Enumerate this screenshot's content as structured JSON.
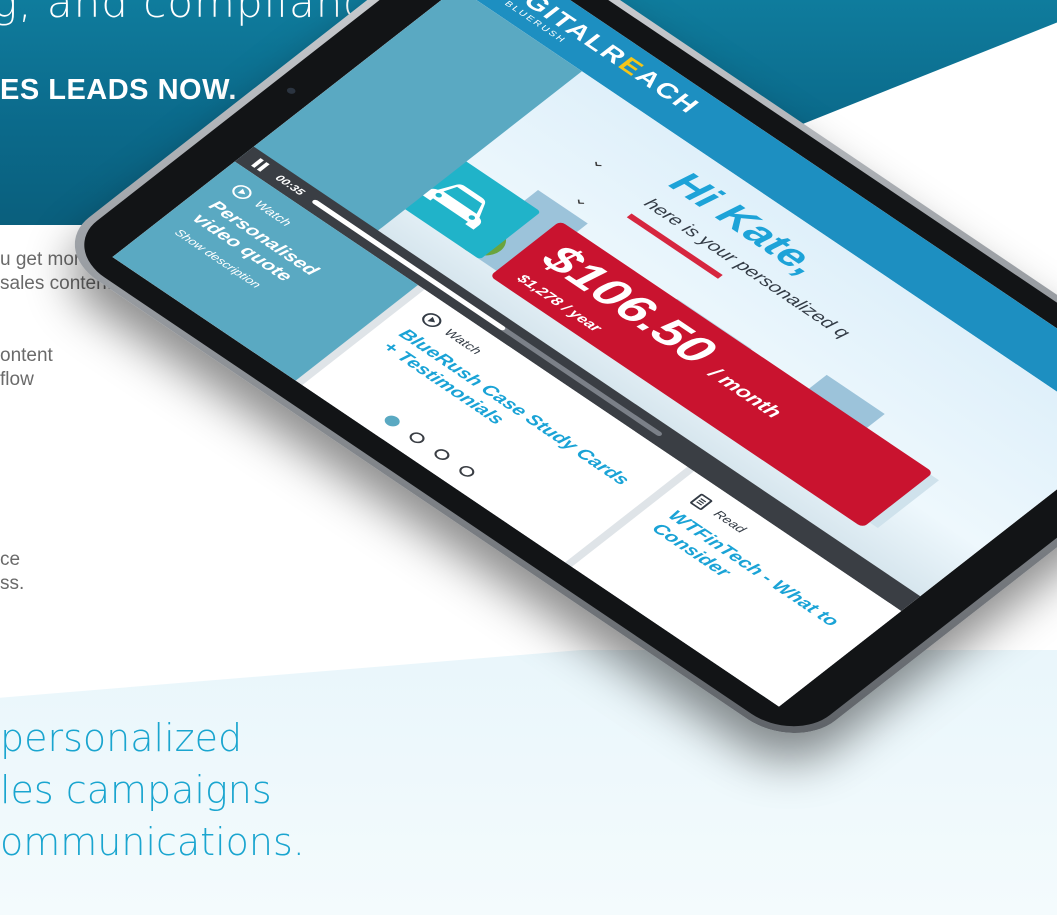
{
  "page": {
    "hero_title": "g, and compliance",
    "hero_cta": "ES LEADS NOW.",
    "body_lines_1": [
      "u get more",
      "sales content."
    ],
    "body_lines_2": [
      "ontent",
      "flow"
    ],
    "body_lines_3": [
      "ce",
      "ss."
    ],
    "tagline": [
      "personalized",
      "les campaigns",
      "ommunications."
    ]
  },
  "tablet": {
    "logo": {
      "main_prefix": "DIGITALR",
      "main_accent": "E",
      "main_suffix": "ACH",
      "sub": "BY BLUERUSH"
    },
    "greeting": "Hi Kate,",
    "greeting_sub": "here is your personalized q",
    "price": {
      "monthly": "$106.50",
      "monthly_unit": "/ month",
      "yearly": "$1,278 / year"
    },
    "player": {
      "time": "00:35",
      "progress": 0.55
    },
    "cards": [
      {
        "kicker": "Watch",
        "title": "Personalised video quote",
        "link": "Show description",
        "icon": "play-circle-icon"
      },
      {
        "kicker": "Watch",
        "title": "BlueRush Case Study Cards + Testimonials",
        "icon": "play-circle-icon"
      },
      {
        "kicker": "Read",
        "title": "WTFinTech - What to Consider",
        "icon": "document-icon"
      }
    ],
    "pager": {
      "count": 4,
      "active_index": 0
    }
  },
  "colors": {
    "brand_blue": "#1d8fc1",
    "accent_red": "#c9132f",
    "teal_tile": "#20b3c9",
    "tagline_blue": "#1aa5cf"
  }
}
